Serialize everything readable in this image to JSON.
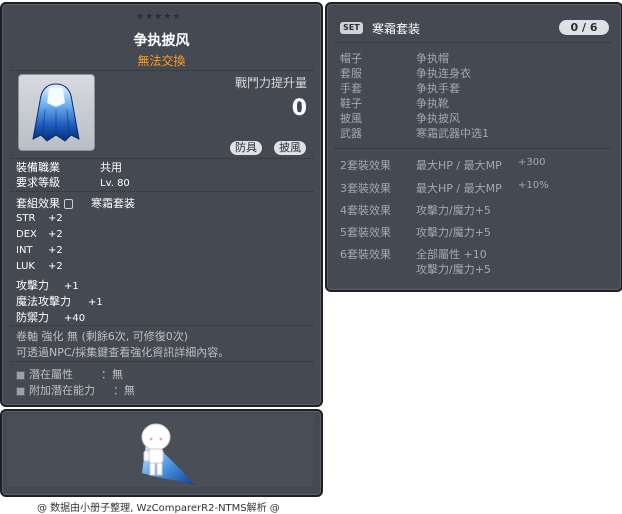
{
  "item": {
    "id": "01102507",
    "stars": "★★★★★",
    "name": "争执披风",
    "tradeability": "無法交換",
    "power_label": "戰鬥力提升量",
    "power_value": "0",
    "tags": [
      "防具",
      "披風"
    ],
    "job_label": "裝備職業",
    "job_value": "共用",
    "level_label": "要求等級",
    "level_value": "Lv. 80",
    "set_label": "套組效果",
    "set_value": "寒霜套装",
    "stats": [
      {
        "name": "STR",
        "value": "+2"
      },
      {
        "name": "DEX",
        "value": "+2"
      },
      {
        "name": "INT",
        "value": "+2"
      },
      {
        "name": "LUK",
        "value": "+2"
      },
      {
        "name": "攻擊力",
        "value": "+1"
      },
      {
        "name": "魔法攻擊力",
        "value": "+1"
      },
      {
        "name": "防禦力",
        "value": "+40"
      }
    ],
    "upgrade_line": "卷軸 強化 無 (剩餘6次, 可修復0次)",
    "info_line": "可透過NPC/採集鍵查看強化資訊詳細內容。",
    "potential_label": "潛在屬性",
    "potential_value": "：無",
    "bonus_potential_label": "附加潛在能力",
    "bonus_potential_value": "：無"
  },
  "set": {
    "badge": "SET",
    "name": "寒霜套装",
    "count": "0 / 6",
    "pieces": [
      {
        "slot": "帽子",
        "item": "争执帽"
      },
      {
        "slot": "套服",
        "item": "争执连身衣"
      },
      {
        "slot": "手套",
        "item": "争执手套"
      },
      {
        "slot": "鞋子",
        "item": "争执靴"
      },
      {
        "slot": "披風",
        "item": "争执披风"
      },
      {
        "slot": "武器",
        "item": "寒霜武器中选1"
      }
    ],
    "effects": [
      {
        "label": "2套裝效果",
        "stat": "最大HP / 最大MP",
        "value": "+300"
      },
      {
        "label": "3套裝效果",
        "stat": "最大HP / 最大MP",
        "value": "+10%"
      },
      {
        "label": "4套裝效果",
        "stat": "攻擊力/魔力+5",
        "value": ""
      },
      {
        "label": "5套裝效果",
        "stat": "攻擊力/魔力+5",
        "value": ""
      },
      {
        "label": "6套裝效果",
        "stat": "全部屬性 +10",
        "value": "",
        "stat2": "攻擊力/魔力+5"
      }
    ]
  },
  "footer": "@ 数据由小册子整理, WzComparerR2-NTMS解析 @",
  "colors": {
    "panel": "#454a52",
    "accent": "#ff9e1a"
  },
  "icons": {
    "item_icon": "cape-icon",
    "preview": "character-preview"
  }
}
